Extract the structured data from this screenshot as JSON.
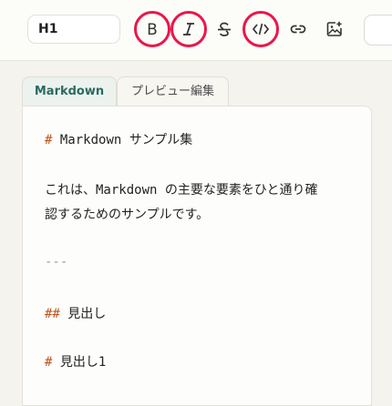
{
  "toolbar": {
    "heading_value": "H1",
    "buttons": [
      {
        "name": "bold",
        "icon": "bold-icon",
        "label": "B",
        "highlighted": true
      },
      {
        "name": "italic",
        "icon": "italic-icon",
        "label": "I",
        "highlighted": true
      },
      {
        "name": "strikethrough",
        "icon": "strikethrough-icon",
        "label": "S",
        "highlighted": false
      },
      {
        "name": "code",
        "icon": "code-icon",
        "label": "</>",
        "highlighted": true
      },
      {
        "name": "link",
        "icon": "link-icon",
        "highlighted": false
      },
      {
        "name": "image",
        "icon": "image-add-icon",
        "highlighted": false
      }
    ],
    "highlight_color": "#e8174a"
  },
  "tabs": [
    {
      "label": "Markdown",
      "active": true
    },
    {
      "label": "プレビュー編集",
      "active": false
    }
  ],
  "editor": {
    "lines": [
      {
        "mark": "#",
        "text": " Markdown サンプル集"
      },
      {
        "mark": "",
        "text": "これは、Markdown の主要な要素をひと通り確"
      },
      {
        "mark": "",
        "text": "認するためのサンプルです。"
      },
      {
        "mark": "---",
        "text": ""
      },
      {
        "mark": "##",
        "text": " 見出し"
      },
      {
        "mark": "#",
        "text": " 見出し1"
      }
    ]
  },
  "colors": {
    "accent": "#2d6a60",
    "markdown_marker": "#c0531d"
  }
}
